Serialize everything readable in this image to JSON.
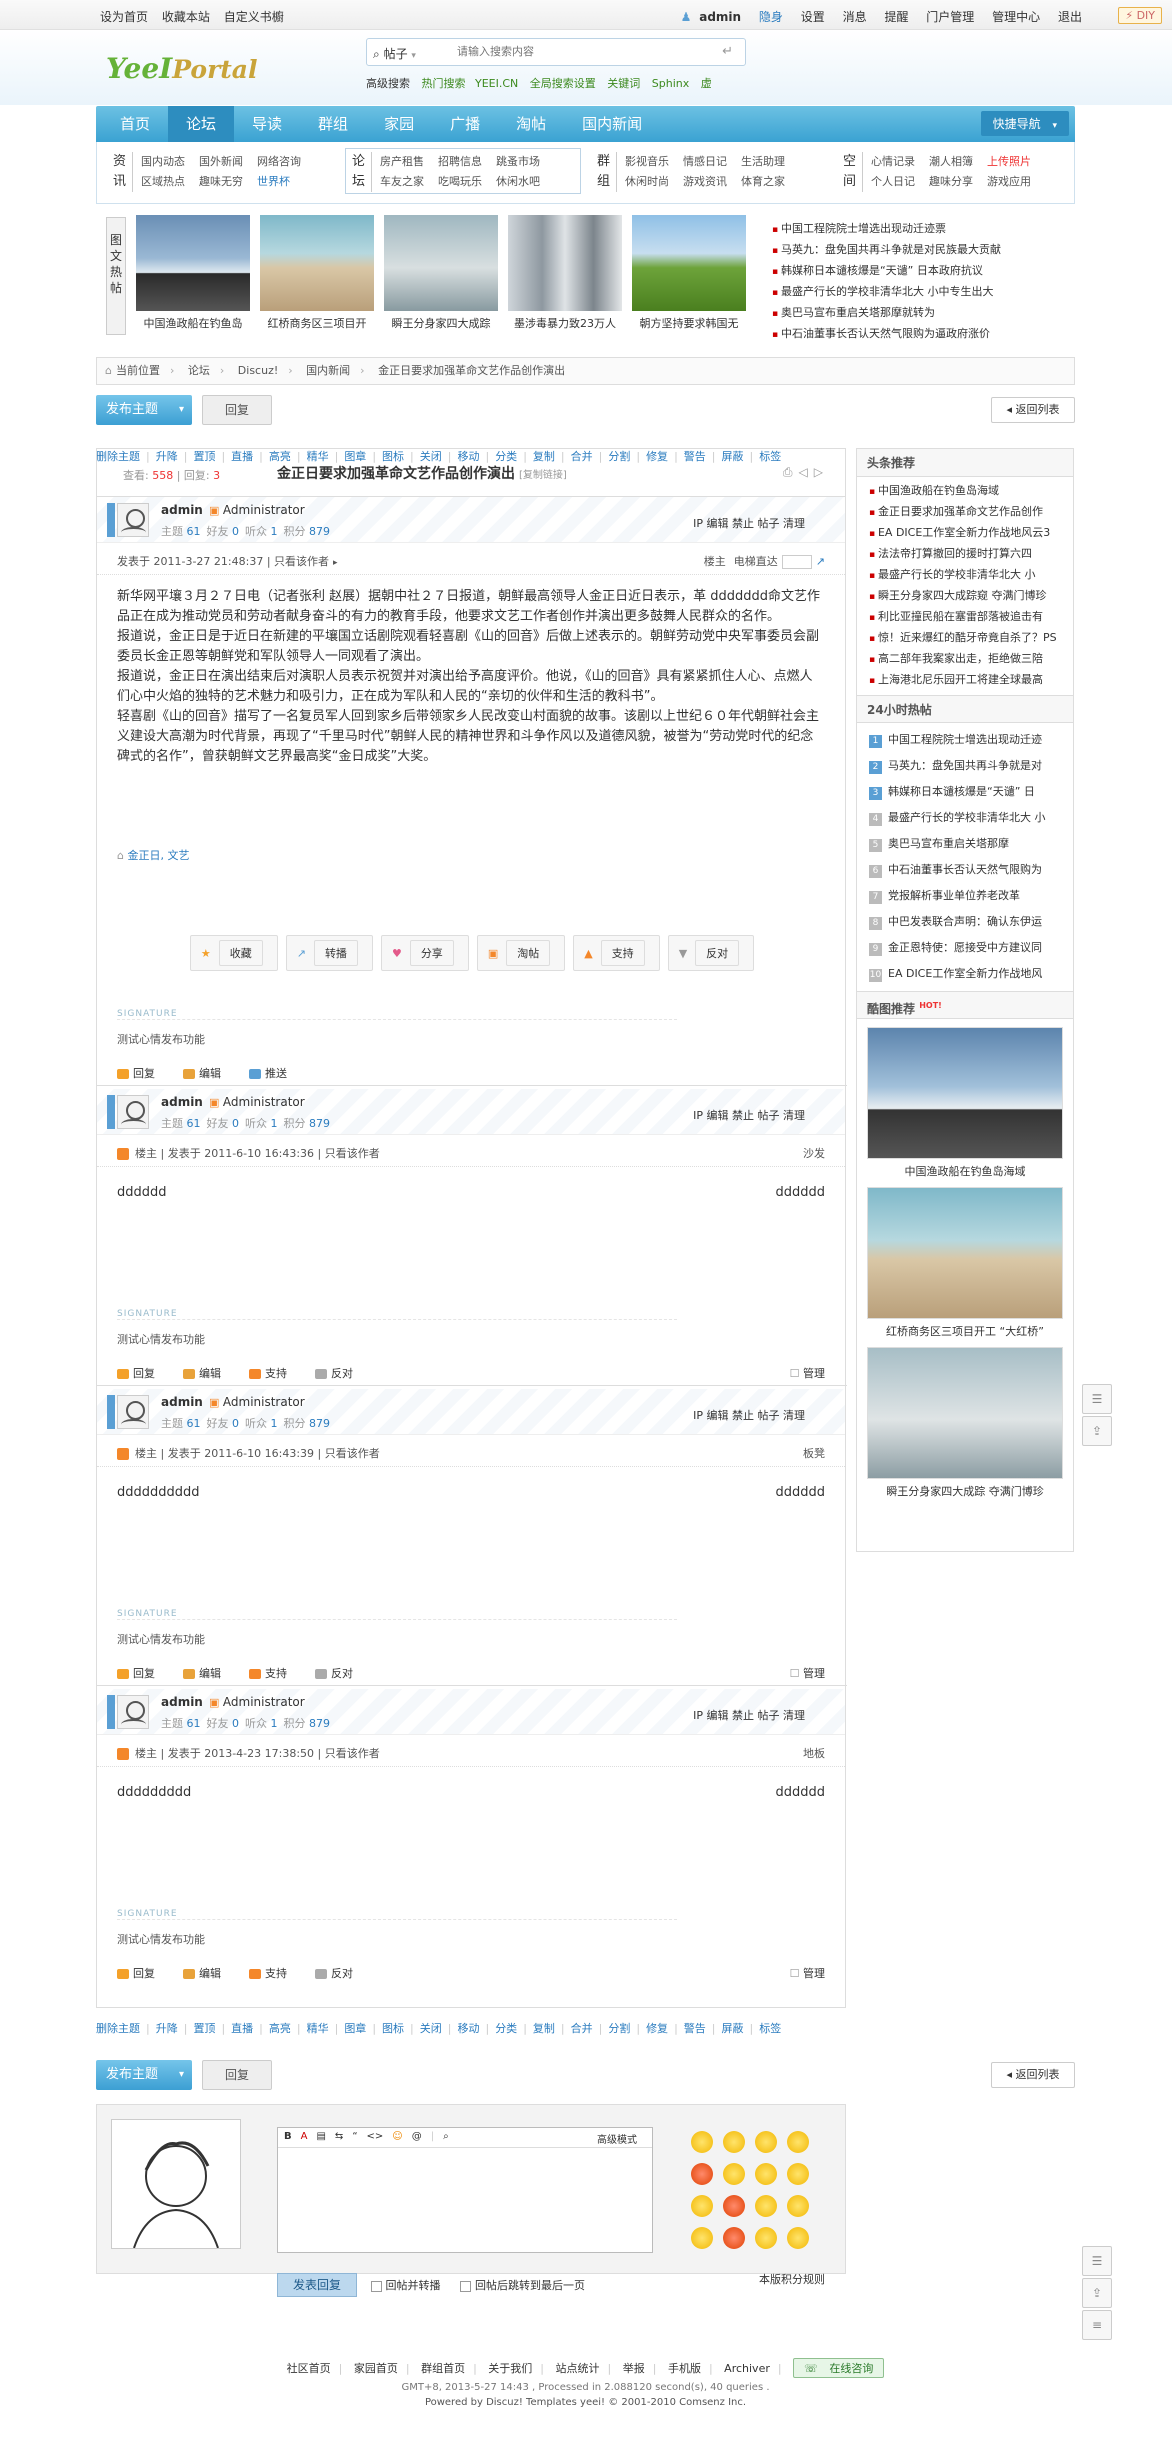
{
  "topbar": {
    "set_home": "设为首页",
    "bookmark": "收藏本站",
    "custom_skin": "自定义书櫥",
    "user": "admin",
    "hide": "隐身",
    "settings": "设置",
    "messages": "消息",
    "remind": "提醒",
    "portal_manage": "门户管理",
    "admin_center": "管理中心",
    "logout": "退出",
    "diy": "DIY"
  },
  "logo": {
    "part1": "YeeI",
    "part2": "Portal"
  },
  "search": {
    "type": "帖子",
    "placeholder": "请输入搜索内容",
    "advanced": "高级搜索",
    "hot_label": "热门搜索",
    "hot": [
      "YEEI.CN",
      "全局搜索设置",
      "关键词",
      "Sphinx",
      "虚"
    ]
  },
  "nav": {
    "items": [
      "首页",
      "论坛",
      "导读",
      "群组",
      "家园",
      "广播",
      "淘帖",
      "国内新闻"
    ],
    "active_index": 1,
    "quick": "快捷导航"
  },
  "subnav": {
    "news": {
      "title": "资讯",
      "items": [
        "国内动态",
        "国外新闻",
        "网络咨询",
        "区域热点",
        "趣味无穷",
        "世界杯"
      ]
    },
    "forum": {
      "title": "论坛",
      "items": [
        "房产租售",
        "招聘信息",
        "跳蚤市场",
        "车友之家",
        "吃喝玩乐",
        "休闲水吧"
      ]
    },
    "group": {
      "title": "群组",
      "items": [
        "影视音乐",
        "情感日记",
        "生活助理",
        "休闲时尚",
        "游戏资讯",
        "体育之家"
      ]
    },
    "space": {
      "title": "空间",
      "items": [
        "心情记录",
        "潮人相簿",
        "上传照片",
        "个人日记",
        "趣味分享",
        "游戏应用"
      ]
    }
  },
  "hotpics": {
    "label": "图文热帖",
    "items": [
      "中国渔政船在钓鱼岛",
      "红桥商务区三项目开",
      "瞬王分身家四大成踪",
      "墨涉毒暴力致23万人",
      "朝方坚持要求韩国无"
    ],
    "list": [
      "中国工程院院士增选出现动迁迹票",
      "马英九：盘免国共再斗争就是对民族最大贡献",
      "韩媒称日本谴核爆是“天谴” 日本政府抗议",
      "最盛产行长的学校非清华北大 小中专生出大",
      "奥巴马宣布重启关塔那摩就转为",
      "中石油董事长否认天然气限购为逼政府涨价"
    ]
  },
  "crumb": {
    "home": "当前位置",
    "items": [
      "论坛",
      "Discuz!",
      "国内新闻",
      "金正日要求加强革命文艺作品创作演出"
    ]
  },
  "actions": {
    "post": "发布主题",
    "reply": "回复",
    "back": "返回列表"
  },
  "admin_tools": [
    "删除主题",
    "升降",
    "置顶",
    "直播",
    "高亮",
    "精华",
    "图章",
    "图标",
    "关闭",
    "移动",
    "分类",
    "复制",
    "合并",
    "分割",
    "修复",
    "警告",
    "屏蔽",
    "标签"
  ],
  "thread": {
    "views_label": "查看:",
    "views": "558",
    "replies_label": "回复:",
    "replies": "3",
    "title": "金正日要求加强革命文艺作品创作演出",
    "copy": "[复制链接]"
  },
  "author": {
    "name": "admin",
    "group": "Administrator",
    "stats": [
      {
        "label": "主题",
        "value": "61"
      },
      {
        "label": "好友",
        "value": "0"
      },
      {
        "label": "听众",
        "value": "1"
      },
      {
        "label": "积分",
        "value": "879"
      }
    ],
    "ops": "IP 编辑 禁止 帖子 清理"
  },
  "first_post": {
    "time": "发表于 2011-3-27 21:48:37",
    "only_author": "只看该作者",
    "floor": "楼主",
    "jump": "电梯直达",
    "paragraphs": [
      "新华网平壤３月２７日电（记者张利 赵展）据朝中社２７日报道，朝鲜最高领导人金正日近日表示，革 ddddddd命文艺作品正在成为推动党员和劳动者献身奋斗的有力的教育手段，他要求文艺工作者创作并演出更多鼓舞人民群众的名作。",
      "报道说，金正日是于近日在新建的平壤国立话剧院观看轻喜剧《山的回音》后做上述表示的。朝鲜劳动党中央军事委员会副委员长金正恩等朝鲜党和军队领导人一同观看了演出。",
      "报道说，金正日在演出结束后对演职人员表示祝贺并对演出给予高度评价。他说，《山的回音》具有紧紧抓住人心、点燃人们心中火焰的独特的艺术魅力和吸引力，正在成为军队和人民的“亲切的伙伴和生活的教科书”。",
      "轻喜剧《山的回音》描写了一名复员军人回到家乡后带领家乡人民改变山村面貌的故事。该剧以上世纪６０年代朝鲜社会主义建设大高潮为时代背景，再现了“千里马时代”朝鲜人民的精神世界和斗争作风以及道德风貌，被誉为“劳动党时代的纪念碑式的名作”，曾获朝鲜文艺界最高奖“金日成奖”大奖。"
    ],
    "tags": "金正日, 文艺",
    "buttons": [
      "收藏",
      "转播",
      "分享",
      "淘帖",
      "支持",
      "反对"
    ]
  },
  "signature": {
    "label": "SIGNATURE",
    "text": "测试心情发布功能"
  },
  "foot1": {
    "reply": "回复",
    "edit": "编辑",
    "push": "推送"
  },
  "foot": {
    "reply": "回复",
    "edit": "编辑",
    "support": "支持",
    "oppose": "反对",
    "manage": "管理"
  },
  "replies": [
    {
      "floor_label": "楼主",
      "time": "发表于 2011-6-10 16:43:36",
      "only": "只看该作者",
      "seat": "沙发",
      "left": "dddddd",
      "right": "dddddd"
    },
    {
      "floor_label": "楼主",
      "time": "发表于 2011-6-10 16:43:39",
      "only": "只看该作者",
      "seat": "板凳",
      "left": "dddddddddd",
      "right": "dddddd"
    },
    {
      "floor_label": "楼主",
      "time": "发表于 2013-4-23 17:38:50",
      "only": "只看该作者",
      "seat": "地板",
      "left": "ddddddddd",
      "right": "dddddd"
    }
  ],
  "side": {
    "hot_title": "头条推荐",
    "hot": [
      "中国渔政船在钓鱼岛海域",
      "金正日要求加强革命文艺作品创作",
      "EA DICE工作室全新力作战地风云3",
      "法法帝打算撤回的援时打算六四",
      "最盛产行长的学校非清华北大 小",
      "瞬王分身家四大成踪窥 夺满门博珍",
      "利比亚撞民船在塞雷部落被追击有",
      "惊！近来爆红的酷牙帝竟自杀了？PS",
      "高二部年我案家出走，拒绝做三陪",
      "上海港北尼乐园开工将建全球最高"
    ],
    "rank_title": "24小时热帖",
    "rank": [
      "中国工程院院士增选出现动迁迹",
      "马英九：盘免国共再斗争就是对",
      "韩媒称日本谴核爆是“天谴” 日",
      "最盛产行长的学校非清华北大 小",
      "奥巴马宣布重启关塔那摩",
      "中石油董事长否认天然气限购为",
      "党报解析事业单位养老改革",
      "中巴发表联合声明：确认东伊运",
      "金正恩特使：愿接受中方建议同",
      "EA DICE工作室全新力作战地风"
    ],
    "pic_title": "酷图推荐",
    "pic_badge": "HOT!",
    "pics": [
      "中国渔政船在钓鱼岛海域",
      "红桥商务区三项目开工 “大红桥”",
      "瞬王分身家四大成踪 夺满门博珍"
    ]
  },
  "editor": {
    "tools": [
      "B",
      "A",
      "▤",
      "⇆",
      "“",
      "<>",
      "☺",
      "@",
      "|",
      "⌕"
    ],
    "advanced": "高级模式",
    "send": "发表回复",
    "chk1": "回帖并转播",
    "chk2": "回帖后跳转到最后一页",
    "credit": "本版积分规则"
  },
  "footer": {
    "links": [
      "社区首页",
      "家园首页",
      "群组首页",
      "关于我们",
      "站点统计",
      "举报",
      "手机版",
      "Archiver"
    ],
    "online": "在线咨询",
    "gmt": "GMT+8, 2013-5-27 14:43 , Processed in 2.088120 second(s), 40 queries .",
    "powered": "Powered by Discuz! Templates yeei! © 2001-2010 Comsenz Inc."
  },
  "colors": {
    "nav": "#3aa2d2",
    "accent": "#2b7cbf",
    "hot": "#e33"
  }
}
